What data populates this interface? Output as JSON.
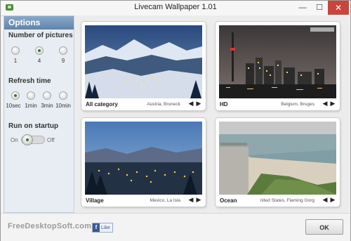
{
  "window": {
    "title": "Livecam Wallpaper 1.01"
  },
  "options": {
    "header": "Options",
    "number_of_pictures": {
      "title": "Number of pictures",
      "choices": [
        "1",
        "4",
        "9"
      ],
      "selected": "4"
    },
    "refresh_time": {
      "title": "Refresh time",
      "choices": [
        "10sec",
        "1min",
        "3min",
        "10min"
      ],
      "selected": "10sec"
    },
    "run_on_startup": {
      "title": "Run on startup",
      "on_label": "On",
      "off_label": "Off",
      "value": "On"
    }
  },
  "cams": [
    {
      "category": "All category",
      "location": "Austria, Bruneck"
    },
    {
      "category": "HD",
      "location": "Belgium, Bruges"
    },
    {
      "category": "Village",
      "location": "Mexico, La Isla"
    },
    {
      "category": "Ocean",
      "location": "nited States, Flaming Gorg"
    }
  ],
  "nav": {
    "prev": "◀",
    "next": "▶"
  },
  "footer": {
    "brand": "FreeDesktopSoft.com",
    "fb_icon": "f",
    "fb_like": "Like",
    "ok": "OK"
  },
  "window_controls": {
    "minimize": "—",
    "maximize": "☐",
    "close": "✕"
  }
}
